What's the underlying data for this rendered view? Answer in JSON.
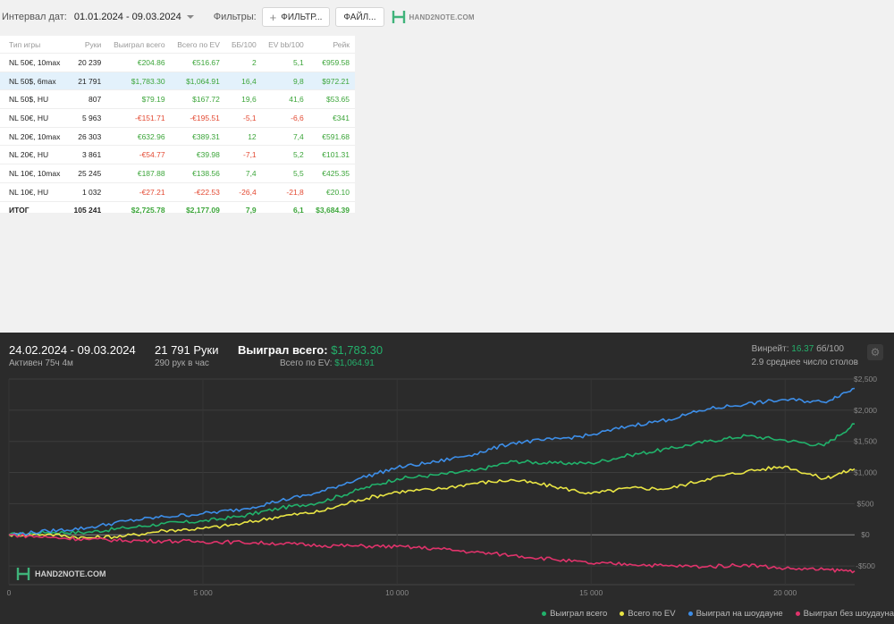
{
  "toolbar": {
    "interval_label": "Интервал дат:",
    "date_range": "01.01.2024 - 09.03.2024",
    "filters_label": "Фильтры:",
    "filter_button": "ФИЛЬТР...",
    "file_button": "ФАЙЛ...",
    "logo_text": "HAND2NOTE.COM"
  },
  "table": {
    "headers": [
      "Тип игры",
      "Руки",
      "Выиграл всего",
      "Всего по EV",
      "ББ/100",
      "EV bb/100",
      "Рейк"
    ],
    "rows": [
      {
        "cells": [
          "NL 50€, 10max",
          "20 239",
          "€204.86",
          "€516.67",
          "2",
          "5,1",
          "€959.58"
        ],
        "tones": [
          "",
          "neu",
          "pos",
          "pos",
          "pos",
          "pos",
          "pos"
        ]
      },
      {
        "cells": [
          "NL 50$, 6max",
          "21 791",
          "$1,783.30",
          "$1,064.91",
          "16,4",
          "9,8",
          "$972.21"
        ],
        "tones": [
          "",
          "neu",
          "pos",
          "pos",
          "pos",
          "pos",
          "pos"
        ],
        "selected": true
      },
      {
        "cells": [
          "NL 50$, HU",
          "807",
          "$79.19",
          "$167.72",
          "19,6",
          "41,6",
          "$53.65"
        ],
        "tones": [
          "",
          "neu",
          "pos",
          "pos",
          "pos",
          "pos",
          "pos"
        ]
      },
      {
        "cells": [
          "NL 50€, HU",
          "5 963",
          "-€151.71",
          "-€195.51",
          "-5,1",
          "-6,6",
          "€341"
        ],
        "tones": [
          "",
          "neu",
          "neg",
          "neg",
          "neg",
          "neg",
          "pos"
        ]
      },
      {
        "cells": [
          "NL 20€, 10max",
          "26 303",
          "€632.96",
          "€389.31",
          "12",
          "7,4",
          "€591.68"
        ],
        "tones": [
          "",
          "neu",
          "pos",
          "pos",
          "pos",
          "pos",
          "pos"
        ]
      },
      {
        "cells": [
          "NL 20€, HU",
          "3 861",
          "-€54.77",
          "€39.98",
          "-7,1",
          "5,2",
          "€101.31"
        ],
        "tones": [
          "",
          "neu",
          "neg",
          "pos",
          "neg",
          "pos",
          "pos"
        ]
      },
      {
        "cells": [
          "NL 10€, 10max",
          "25 245",
          "€187.88",
          "€138.56",
          "7,4",
          "5,5",
          "€425.35"
        ],
        "tones": [
          "",
          "neu",
          "pos",
          "pos",
          "pos",
          "pos",
          "pos"
        ]
      },
      {
        "cells": [
          "NL 10€, HU",
          "1 032",
          "-€27.21",
          "-€22.53",
          "-26,4",
          "-21,8",
          "€20.10"
        ],
        "tones": [
          "",
          "neu",
          "neg",
          "neg",
          "neg",
          "neg",
          "pos"
        ]
      }
    ],
    "total": {
      "cells": [
        "ИТОГ",
        "105 241",
        "$2,725.78",
        "$2,177.09",
        "7,9",
        "6,1",
        "$3,684.39"
      ],
      "tones": [
        "",
        "neu",
        "pos",
        "pos",
        "pos",
        "pos",
        "pos"
      ]
    }
  },
  "summary": {
    "date_range": "24.02.2024 - 09.03.2024",
    "active": "Активен 75ч 4м",
    "hands": "21 791 Руки",
    "hands_per_hour": "290 рук в час",
    "won_label": "Выиграл всего:",
    "won_value": "$1,783.30",
    "ev_label": "Всего по EV:",
    "ev_value": "$1,064.91",
    "winrate_label": "Винрейт:",
    "winrate_value": "16.37",
    "winrate_unit": "бб/100",
    "avg_tables": "2.9 среднее число столов"
  },
  "colors": {
    "won_total": "#21b26b",
    "ev_total": "#e9e544",
    "showdown": "#3d8ee8",
    "non_showdown": "#e0336b"
  },
  "chart_data": {
    "type": "line",
    "x_ticks": [
      0,
      5000,
      10000,
      15000,
      20000
    ],
    "x_tick_labels": [
      "0",
      "5 000",
      "10 000",
      "15 000",
      "20 000"
    ],
    "xlim": [
      0,
      21791
    ],
    "y_ticks": [
      2500,
      2000,
      1500,
      1000,
      500,
      0,
      -500
    ],
    "y_tick_labels": [
      "$2,500",
      "$2,000",
      "$1,500",
      "$1,000",
      "$500",
      "$0",
      "-$500"
    ],
    "ylim": [
      -800,
      2500
    ],
    "grid": true,
    "legend_position": "bottom-right",
    "series": [
      {
        "name": "Выиграл всего",
        "color": "#21b26b",
        "x": [
          0,
          1000,
          2000,
          3000,
          4000,
          5000,
          6000,
          7000,
          8000,
          9000,
          10000,
          11000,
          12000,
          13000,
          14000,
          15000,
          16000,
          17000,
          18000,
          19000,
          20000,
          21000,
          21791
        ],
        "values": [
          0,
          40,
          40,
          110,
          180,
          220,
          300,
          430,
          520,
          720,
          900,
          960,
          1030,
          1180,
          1150,
          1150,
          1280,
          1380,
          1500,
          1590,
          1520,
          1430,
          1780
        ]
      },
      {
        "name": "Всего по EV",
        "color": "#e9e544",
        "x": [
          0,
          1000,
          2000,
          3000,
          4000,
          5000,
          6000,
          7000,
          8000,
          9000,
          10000,
          11000,
          12000,
          13000,
          14000,
          15000,
          16000,
          17000,
          18000,
          19000,
          20000,
          21000,
          21791
        ],
        "values": [
          0,
          10,
          -50,
          -20,
          70,
          100,
          180,
          300,
          370,
          560,
          690,
          730,
          830,
          880,
          780,
          660,
          750,
          740,
          900,
          1020,
          1100,
          900,
          1060
        ]
      },
      {
        "name": "Выиграл на шоудауне",
        "color": "#3d8ee8",
        "x": [
          0,
          1000,
          2000,
          3000,
          4000,
          5000,
          6000,
          7000,
          8000,
          9000,
          10000,
          11000,
          12000,
          13000,
          14000,
          15000,
          16000,
          17000,
          18000,
          19000,
          20000,
          21000,
          21791
        ],
        "values": [
          0,
          60,
          110,
          220,
          290,
          340,
          410,
          550,
          680,
          900,
          1080,
          1170,
          1300,
          1480,
          1530,
          1600,
          1750,
          1850,
          2020,
          2100,
          2170,
          2130,
          2350
        ]
      },
      {
        "name": "Выиграл без шоудауна",
        "color": "#e0336b",
        "x": [
          0,
          1000,
          2000,
          3000,
          4000,
          5000,
          6000,
          7000,
          8000,
          9000,
          10000,
          11000,
          12000,
          13000,
          14000,
          15000,
          16000,
          17000,
          18000,
          19000,
          20000,
          21000,
          21791
        ],
        "values": [
          0,
          -40,
          -70,
          -90,
          -100,
          -110,
          -120,
          -140,
          -170,
          -180,
          -190,
          -220,
          -280,
          -330,
          -390,
          -460,
          -470,
          -500,
          -510,
          -480,
          -540,
          -560,
          -580
        ]
      }
    ]
  }
}
